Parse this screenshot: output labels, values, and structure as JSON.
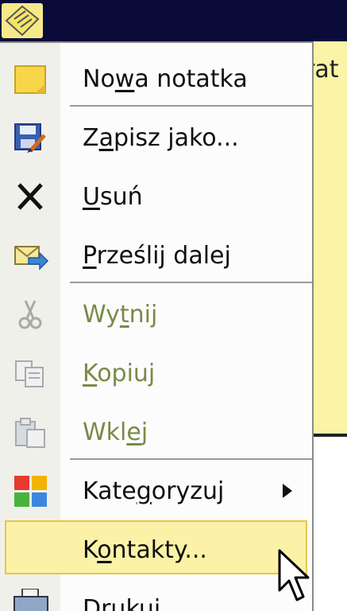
{
  "window": {
    "title_icon": "note-icon",
    "body_text": "rat"
  },
  "menu": {
    "items": [
      {
        "label_pre": "No",
        "label_u": "w",
        "label_post": "a notatka",
        "icon": "sticky-note-icon",
        "enabled": true
      },
      {
        "label_pre": "Z",
        "label_u": "a",
        "label_post": "pisz jako...",
        "icon": "save-as-icon",
        "enabled": true
      },
      {
        "label_pre": "",
        "label_u": "U",
        "label_post": "suń",
        "icon": "delete-x-icon",
        "enabled": true
      },
      {
        "label_pre": "",
        "label_u": "P",
        "label_post": "rześlij dalej",
        "icon": "forward-envelope-icon",
        "enabled": true
      },
      {
        "label_pre": "Wy",
        "label_u": "t",
        "label_post": "nij",
        "icon": "scissors-icon",
        "enabled": false
      },
      {
        "label_pre": "",
        "label_u": "K",
        "label_post": "opiuj",
        "icon": "copy-icon",
        "enabled": false
      },
      {
        "label_pre": "Wkl",
        "label_u": "e",
        "label_post": "j",
        "icon": "paste-icon",
        "enabled": false
      },
      {
        "label_pre": "Kate",
        "label_u": "g",
        "label_post": "oryzuj",
        "icon": "categories-icon",
        "enabled": true
      },
      {
        "label_pre": "K",
        "label_u": "o",
        "label_post": "ntakty...",
        "icon": "contacts-icon",
        "enabled": true
      },
      {
        "label_pre": "Drukuj",
        "label_u": "",
        "label_post": "",
        "icon": "printer-icon",
        "enabled": true
      }
    ],
    "highlighted_item": "Kontakty...",
    "submenu_arrow_icon": "submenu-arrow-icon",
    "cursor_icon": "mouse-pointer-icon"
  }
}
